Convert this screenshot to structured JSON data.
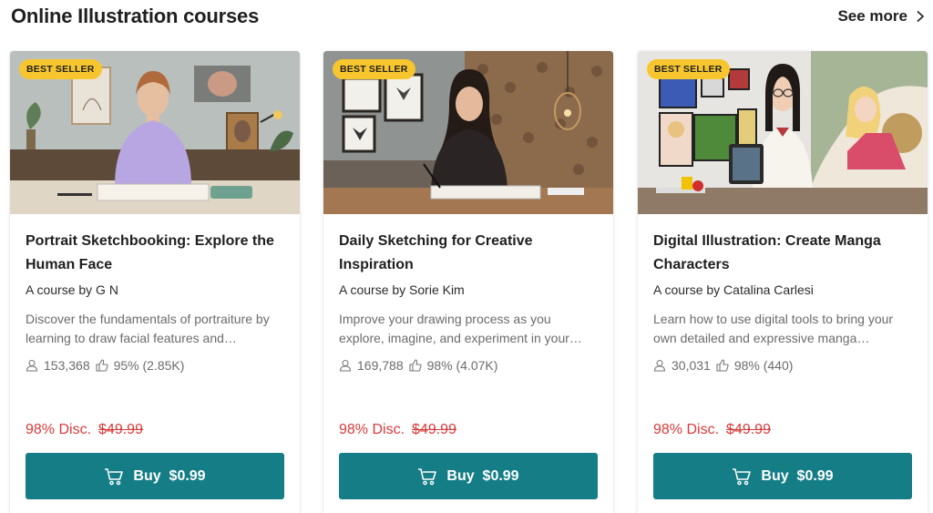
{
  "section": {
    "title": "Online Illustration courses",
    "see_more_label": "See more"
  },
  "colors": {
    "badge": "#f7c62f",
    "buy_button": "#147d86",
    "discount_text": "#d93a3a"
  },
  "courses": [
    {
      "badge": "BEST SELLER",
      "title": "Portrait Sketchbooking: Explore the Human Face",
      "author": "A course by G N",
      "description": "Discover the fundamentals of portraiture by learning to draw facial features and expressions",
      "students": "153,368",
      "rating": "95% (2.85K)",
      "discount": "98% Disc.",
      "old_price": "$49.99",
      "buy_label": "Buy  $0.99"
    },
    {
      "badge": "BEST SELLER",
      "title": "Daily Sketching for Creative Inspiration",
      "author": "A course by Sorie Kim",
      "description": "Improve your drawing process as you explore, imagine, and experiment in your sketchbook",
      "students": "169,788",
      "rating": "98% (4.07K)",
      "discount": "98% Disc.",
      "old_price": "$49.99",
      "buy_label": "Buy  $0.99"
    },
    {
      "badge": "BEST SELLER",
      "title": "Digital Illustration: Create Manga Characters",
      "author": "A course by Catalina Carlesi",
      "description": "Learn how to use digital tools to bring your own detailed and expressive manga characters",
      "students": "30,031",
      "rating": "98% (440)",
      "discount": "98% Disc.",
      "old_price": "$49.99",
      "buy_label": "Buy  $0.99"
    }
  ]
}
